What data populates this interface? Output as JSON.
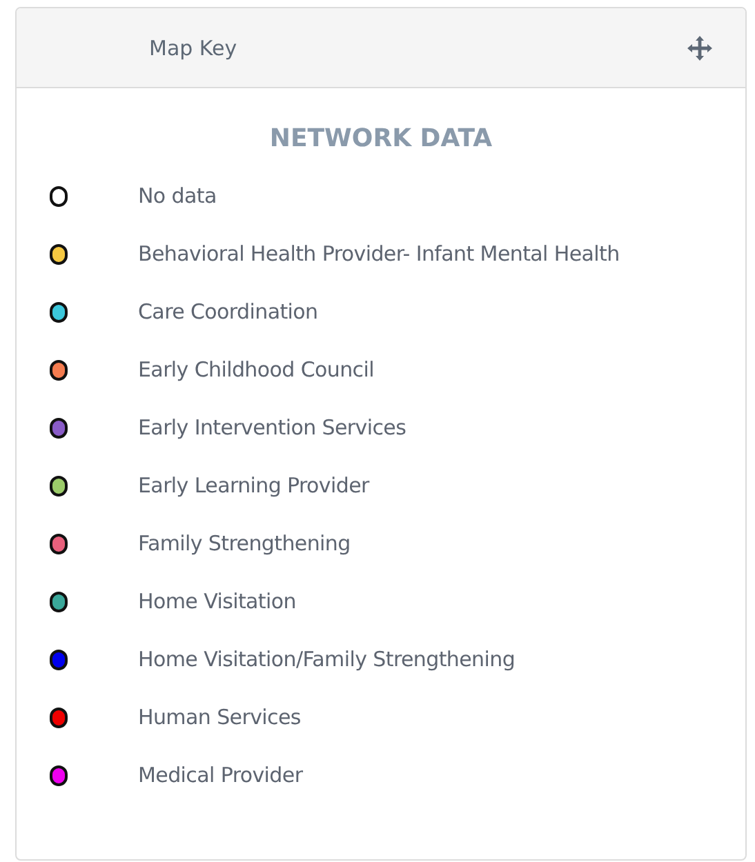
{
  "panel": {
    "title": "Map Key"
  },
  "legend": {
    "heading": "NETWORK DATA",
    "items": [
      {
        "label": "No data",
        "color": "#ffffff"
      },
      {
        "label": "Behavioral Health Provider- Infant Mental Health",
        "color": "#f5c842"
      },
      {
        "label": "Care Coordination",
        "color": "#3cc8dc"
      },
      {
        "label": "Early Childhood Council",
        "color": "#f47c50"
      },
      {
        "label": "Early Intervention Services",
        "color": "#8a5cc8"
      },
      {
        "label": "Early Learning Provider",
        "color": "#9ccc6a"
      },
      {
        "label": "Family Strengthening",
        "color": "#e8607c"
      },
      {
        "label": "Home Visitation",
        "color": "#3aa89a"
      },
      {
        "label": "Home Visitation/Family Strengthening",
        "color": "#0000ee"
      },
      {
        "label": "Human Services",
        "color": "#ee0000"
      },
      {
        "label": "Medical Provider",
        "color": "#ee00ee"
      }
    ]
  }
}
